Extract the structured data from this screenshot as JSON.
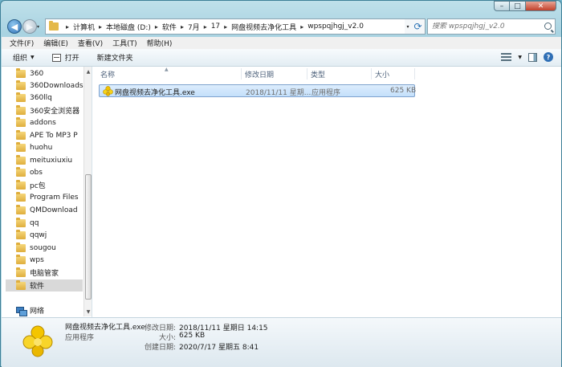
{
  "window": {
    "caption": {
      "minimize": "–",
      "maximize": "□",
      "close": "✕"
    }
  },
  "nav": {
    "back_icon": "back-arrow-icon",
    "forward_icon": "forward-arrow-icon",
    "recent_caret": "▾"
  },
  "address": {
    "crumbs": [
      "计算机",
      "本地磁盘 (D:)",
      "软件",
      "7月",
      "17",
      "网盘视频去净化工具",
      "wpspqjhgj_v2.0"
    ],
    "separator": "▸"
  },
  "search": {
    "placeholder": "搜索 wpspqjhgj_v2.0"
  },
  "menu": [
    "文件(F)",
    "编辑(E)",
    "查看(V)",
    "工具(T)",
    "帮助(H)"
  ],
  "toolbar": {
    "organize": "组织",
    "print": "打开",
    "new_folder": "新建文件夹"
  },
  "sidebar": {
    "items": [
      "360",
      "360Downloads",
      "360llq",
      "360安全浏览器",
      "addons",
      "APE To MP3 P",
      "huohu",
      "meituxiuxiu",
      "obs",
      "pc包",
      "Program Files",
      "QMDownload",
      "qq",
      "qqwj",
      "sougou",
      "wps",
      "电脑管家",
      "软件"
    ],
    "selected": "软件",
    "network": "网络"
  },
  "columns": {
    "name": "名称",
    "modified": "修改日期",
    "type": "类型",
    "size": "大小"
  },
  "files": [
    {
      "name": "网盘视频去净化工具.exe",
      "modified": "2018/11/11 星期...",
      "type": "应用程序",
      "size": "625 KB"
    }
  ],
  "details": {
    "name": "网盘视频去净化工具.exe",
    "type": "应用程序",
    "modified_label": "修改日期:",
    "modified": "2018/11/11 星期日 14:15",
    "size_label": "大小:",
    "size": "625 KB",
    "created_label": "创建日期:",
    "created": "2020/7/17 星期五 8:41"
  }
}
